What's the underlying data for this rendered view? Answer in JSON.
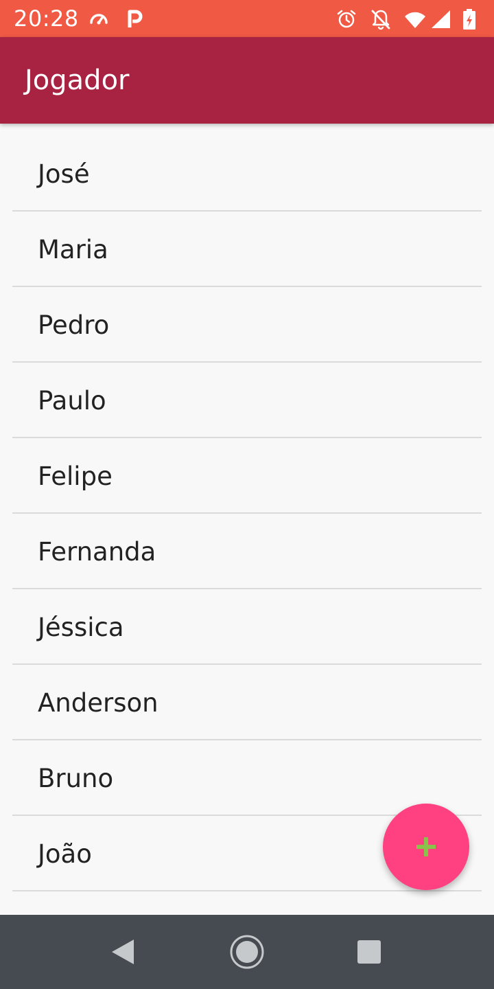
{
  "status_bar": {
    "time": "20:28",
    "left_icons": [
      "speedometer-icon",
      "parking-app-icon"
    ],
    "right_icons": [
      "alarm-icon",
      "notifications-off-icon",
      "wifi-icon",
      "cell-signal-icon",
      "battery-charging-icon"
    ]
  },
  "app_bar": {
    "title": "Jogador",
    "color": "#a82242"
  },
  "players": [
    {
      "name": "José"
    },
    {
      "name": "Maria"
    },
    {
      "name": "Pedro"
    },
    {
      "name": "Paulo"
    },
    {
      "name": "Felipe"
    },
    {
      "name": "Fernanda"
    },
    {
      "name": "Jéssica"
    },
    {
      "name": "Anderson"
    },
    {
      "name": "Bruno"
    },
    {
      "name": "João"
    }
  ],
  "fab": {
    "icon": "plus-icon",
    "color": "#ff4081",
    "icon_color": "#8bc34a"
  },
  "nav_bar": {
    "buttons": [
      "back-icon",
      "home-icon",
      "recents-icon"
    ]
  },
  "colors": {
    "status_bar": "#f05a44",
    "background": "#f8f8f8",
    "nav_bar": "#454b51"
  }
}
